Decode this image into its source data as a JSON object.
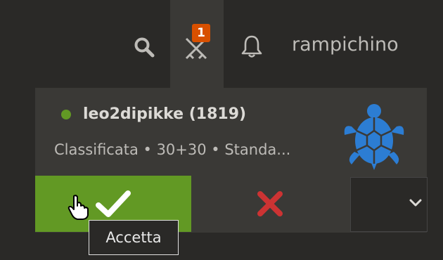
{
  "header": {
    "username": "rampichino",
    "challenge_badge_count": "1",
    "icons": [
      "search-icon",
      "crossed-swords-icon",
      "bell-icon"
    ]
  },
  "challenge": {
    "opponent": "leo2dipikke (1819)",
    "online_status": "online",
    "details": "Classificata • 30+30 • Standa...",
    "variant_icon": "turtle-icon",
    "accept_icon": "checkmark-icon",
    "decline_icon": "x-icon",
    "more_icon": "chevron-down-icon"
  },
  "tooltip": {
    "text": "Accetta"
  },
  "colors": {
    "background": "#2a2927",
    "panel": "#3a3936",
    "accept_green": "#629924",
    "decline_red": "#cc3333",
    "badge_orange": "#d85000",
    "turtle_blue": "#2c7dd3",
    "online_dot": "#629924"
  }
}
